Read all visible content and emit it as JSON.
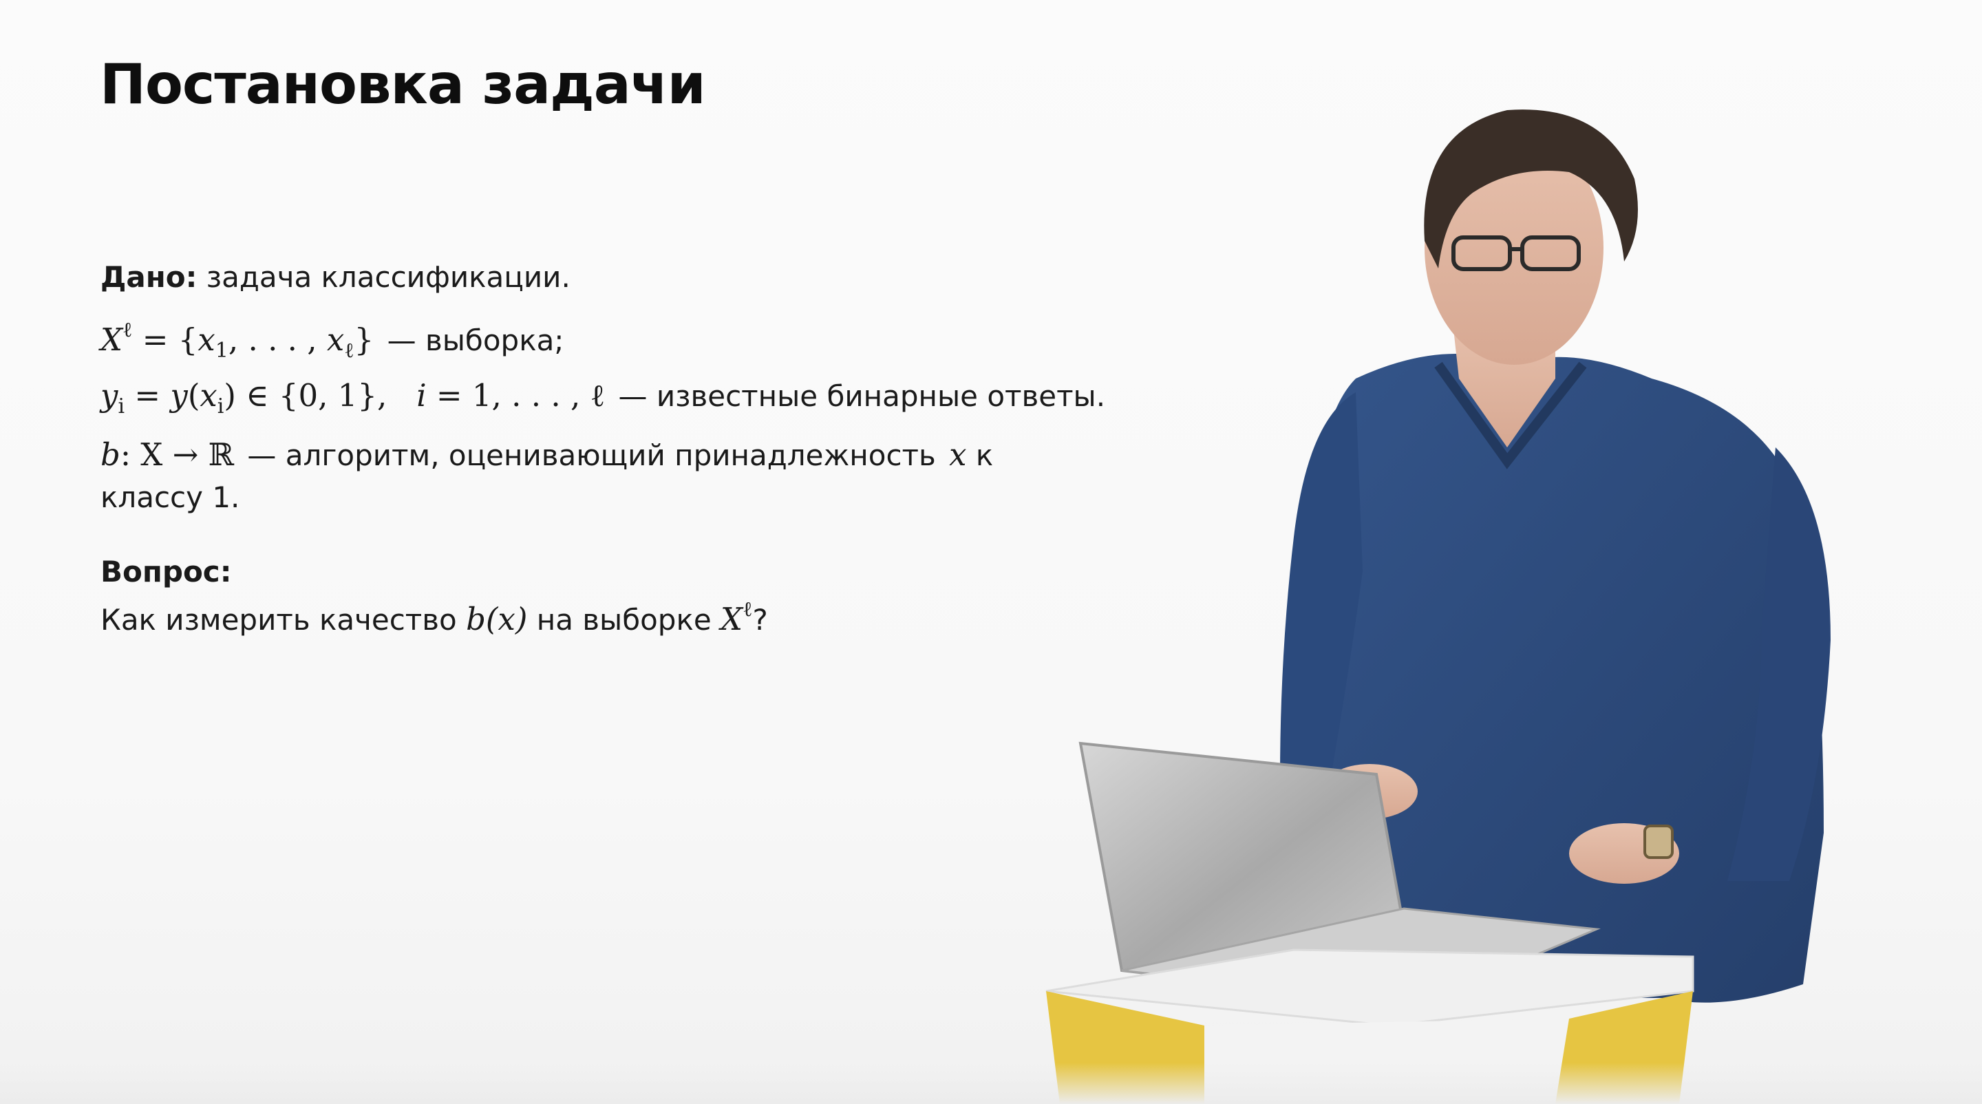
{
  "slide": {
    "title": "Постановка задачи",
    "given_label": "Дано:",
    "given_text": "задача классификации.",
    "sample_lhs_var": "X",
    "sample_lhs_sup": "ℓ",
    "sample_eq": " = {",
    "sample_x1": "x",
    "sample_x1_sub": "1",
    "sample_dots": ", . . . , ",
    "sample_xl": "x",
    "sample_xl_sub": "ℓ",
    "sample_close": "}",
    "sample_text": "— выборка;",
    "answers_y": "y",
    "answers_y_sub": "i",
    "answers_eq": " = ",
    "answers_y2": "y",
    "answers_paren_open": "(",
    "answers_x": "x",
    "answers_x_sub": "i",
    "answers_paren_close": ")",
    "answers_in": " ∈ {0, 1},   ",
    "answers_i": "i",
    "answers_range": " = 1, . . . , ℓ",
    "answers_text": "— известные бинарные ответы.",
    "algo_b": "b",
    "algo_map": ": X → ℝ",
    "algo_text_1": "— алгоритм, оценивающий принадлежность",
    "algo_x": "x",
    "algo_text_2": "к",
    "algo_text_3": "классу 1.",
    "question_label": "Вопрос:",
    "question_text_1": "Как измерить качество",
    "question_bx": "b(x)",
    "question_text_2": "на выборке",
    "question_X": "X",
    "question_sup": "ℓ",
    "question_mark": "?"
  },
  "colors": {
    "background": "#f9f9f9",
    "sweater": "#2f4f7f",
    "laptop": "#b9b9b9",
    "podium_yellow": "#e6c542",
    "podium_white": "#f0f0f0"
  }
}
